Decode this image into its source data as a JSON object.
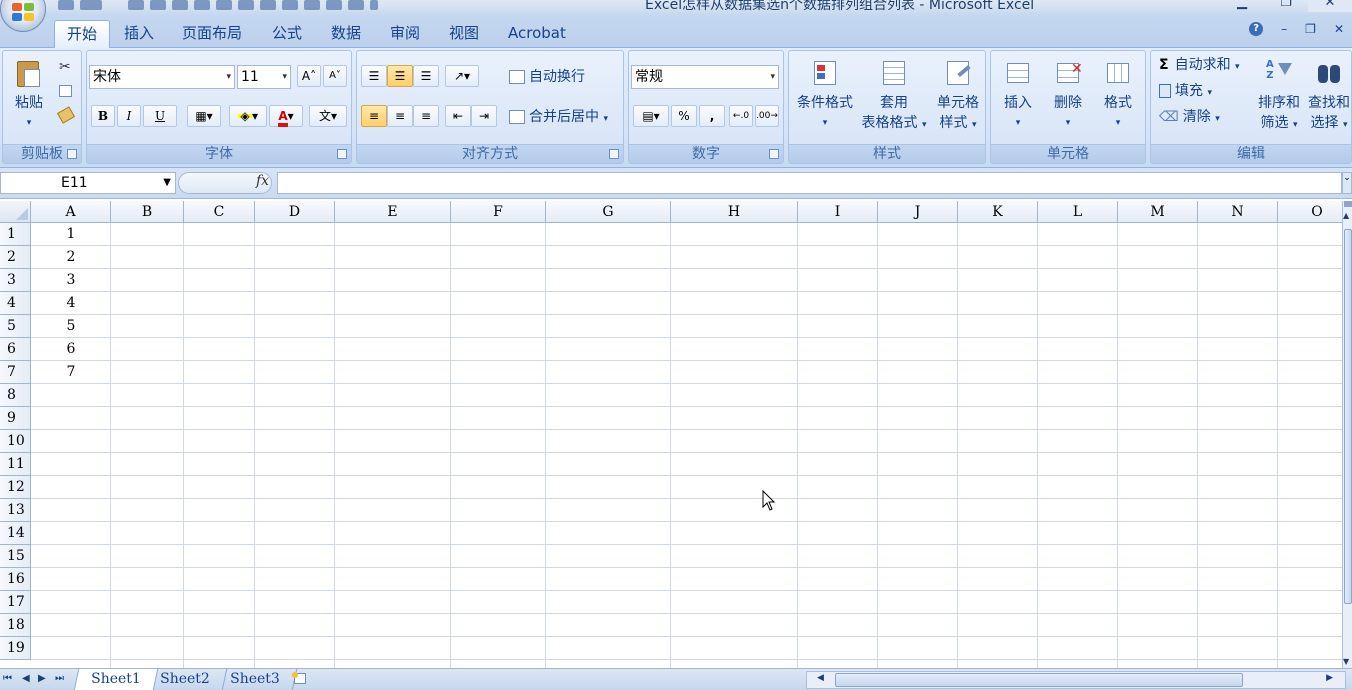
{
  "window": {
    "title": "Excel怎样从数据集选n个数据排列组合列表 - Microsoft Excel"
  },
  "ribbon_tabs": [
    "开始",
    "插入",
    "页面布局",
    "公式",
    "数据",
    "审阅",
    "视图",
    "Acrobat"
  ],
  "ribbon": {
    "clipboard": {
      "paste_label": "粘贴",
      "group_label": "剪贴板"
    },
    "font": {
      "font_name": "宋体",
      "font_size": "11",
      "group_label": "字体",
      "bold": "B",
      "italic": "I",
      "underline": "U"
    },
    "alignment": {
      "wrap_text": "自动换行",
      "merge_center": "合并后居中",
      "group_label": "对齐方式"
    },
    "number": {
      "format": "常规",
      "percent": "%",
      "comma": ",",
      "group_label": "数字"
    },
    "styles": {
      "conditional_format": "条件格式",
      "table_format_1": "套用",
      "table_format_2": "表格格式",
      "cell_styles_1": "单元格",
      "cell_styles_2": "样式",
      "group_label": "样式"
    },
    "cells": {
      "insert": "插入",
      "delete": "删除",
      "format": "格式",
      "group_label": "单元格"
    },
    "editing": {
      "autosum": "自动求和",
      "fill": "填充",
      "clear": "清除",
      "sort_filter_1": "排序和",
      "sort_filter_2": "筛选",
      "find_select_1": "查找和",
      "find_select_2": "选择",
      "group_label": "编辑"
    }
  },
  "formula_bar": {
    "name_box": "E11",
    "fx_label": "fx",
    "formula": ""
  },
  "columns": [
    "A",
    "B",
    "C",
    "D",
    "E",
    "F",
    "G",
    "H",
    "I",
    "J",
    "K",
    "L",
    "M",
    "N",
    "O"
  ],
  "rows": [
    "1",
    "2",
    "3",
    "4",
    "5",
    "6",
    "7",
    "8",
    "9",
    "10",
    "11",
    "12",
    "13",
    "14",
    "15",
    "16",
    "17",
    "18",
    "19"
  ],
  "cells_A": [
    "1",
    "2",
    "3",
    "4",
    "5",
    "6",
    "7"
  ],
  "sheets": [
    "Sheet1",
    "Sheet2",
    "Sheet3"
  ],
  "active_sheet": "Sheet1",
  "colors": {
    "accent": "#15428b",
    "ribbon_bg": "#d6e4f6",
    "grid_line": "#d0d7e5",
    "selected_button": "#ffcf6a"
  }
}
